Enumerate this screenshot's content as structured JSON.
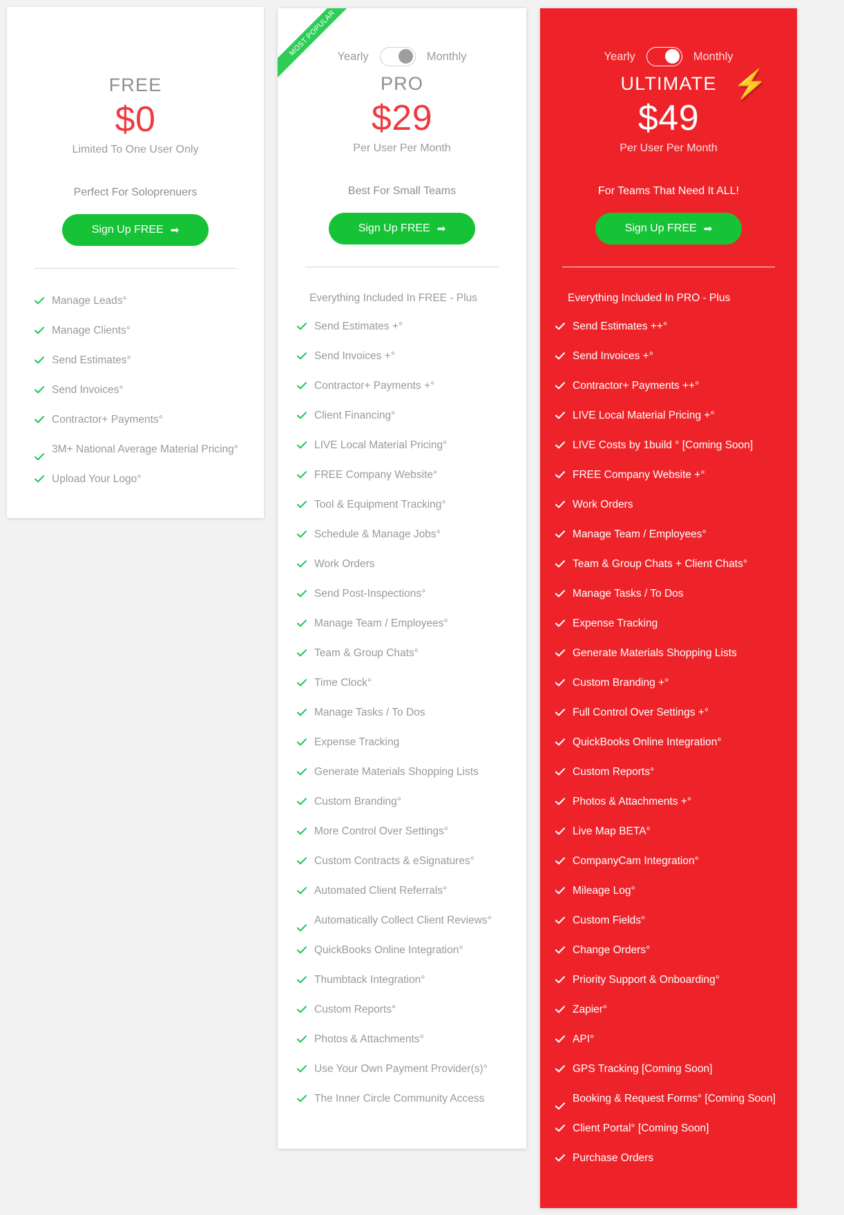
{
  "colors": {
    "accent_red": "#ee2329",
    "price_red": "#ee3b42",
    "cta_green": "#16c336",
    "ribbon_green": "#2fcc57",
    "text_gray": "#9a9a9a",
    "page_bg": "#f2f2f2"
  },
  "toggle": {
    "yearly_label": "Yearly",
    "monthly_label": "Monthly",
    "selected": "Monthly"
  },
  "plans": [
    {
      "id": "free",
      "name": "FREE",
      "price": "$0",
      "price_note": "Limited To One User Only",
      "tagline": "Perfect For Soloprenuers",
      "cta_label": "Sign Up FREE",
      "cta_arrow": "➡",
      "has_toggle": false,
      "ribbon": null,
      "intro": null,
      "features": [
        "Manage Leads°",
        "Manage Clients°",
        "Send Estimates°",
        "Send Invoices°",
        "Contractor+ Payments°",
        "3M+ National Average Material Pricing°",
        "Upload Your Logo°"
      ]
    },
    {
      "id": "pro",
      "name": "PRO",
      "price": "$29",
      "price_note": "Per User Per Month",
      "tagline": "Best For Small Teams",
      "cta_label": "Sign Up FREE",
      "cta_arrow": "➡",
      "has_toggle": true,
      "ribbon": "MOST POPULAR",
      "intro": "Everything Included In FREE - Plus",
      "features": [
        "Send Estimates +°",
        "Send Invoices +°",
        "Contractor+ Payments +°",
        "Client Financing°",
        "LIVE Local Material Pricing°",
        "FREE Company Website°",
        "Tool & Equipment Tracking°",
        "Schedule & Manage Jobs°",
        "Work Orders",
        "Send Post-Inspections°",
        "Manage Team / Employees°",
        "Team & Group Chats°",
        "Time Clock°",
        "Manage Tasks / To Dos",
        "Expense Tracking",
        "Generate Materials Shopping Lists",
        "Custom Branding°",
        "More Control Over Settings°",
        "Custom Contracts & eSignatures°",
        "Automated Client Referrals°",
        "Automatically Collect Client Reviews°",
        "QuickBooks Online Integration°",
        "Thumbtack Integration°",
        "Custom Reports°",
        "Photos & Attachments°",
        "Use Your Own Payment Provider(s)°",
        "The Inner Circle Community Access"
      ]
    },
    {
      "id": "ultimate",
      "name": "ULTIMATE",
      "price": "$49",
      "price_note": "Per User Per Month",
      "tagline": "For Teams That Need It ALL!",
      "cta_label": "Sign Up FREE",
      "cta_arrow": "➡",
      "has_toggle": true,
      "ribbon": null,
      "badge_icon": "lightning-bolt-icon",
      "badge_glyph": "⚡",
      "intro": "Everything Included In PRO - Plus",
      "features": [
        "Send Estimates ++°",
        "Send Invoices +°",
        "Contractor+ Payments ++°",
        "LIVE Local Material Pricing +°",
        "LIVE Costs by 1build ° [Coming Soon]",
        "FREE Company Website +°",
        "Work Orders",
        "Manage Team / Employees°",
        "Team & Group Chats + Client Chats°",
        "Manage Tasks / To Dos",
        "Expense Tracking",
        "Generate Materials Shopping Lists",
        "Custom Branding +°",
        "Full Control Over Settings +°",
        "QuickBooks Online Integration°",
        "Custom Reports°",
        "Photos & Attachments +°",
        "Live Map BETA°",
        "CompanyCam Integration°",
        "Mileage Log°",
        "Custom Fields°",
        "Change Orders°",
        "Priority Support & Onboarding°",
        "Zapier°",
        "API°",
        "GPS Tracking [Coming Soon]",
        "Booking & Request Forms° [Coming Soon]",
        "Client Portal° [Coming Soon]",
        "Purchase Orders"
      ]
    }
  ]
}
